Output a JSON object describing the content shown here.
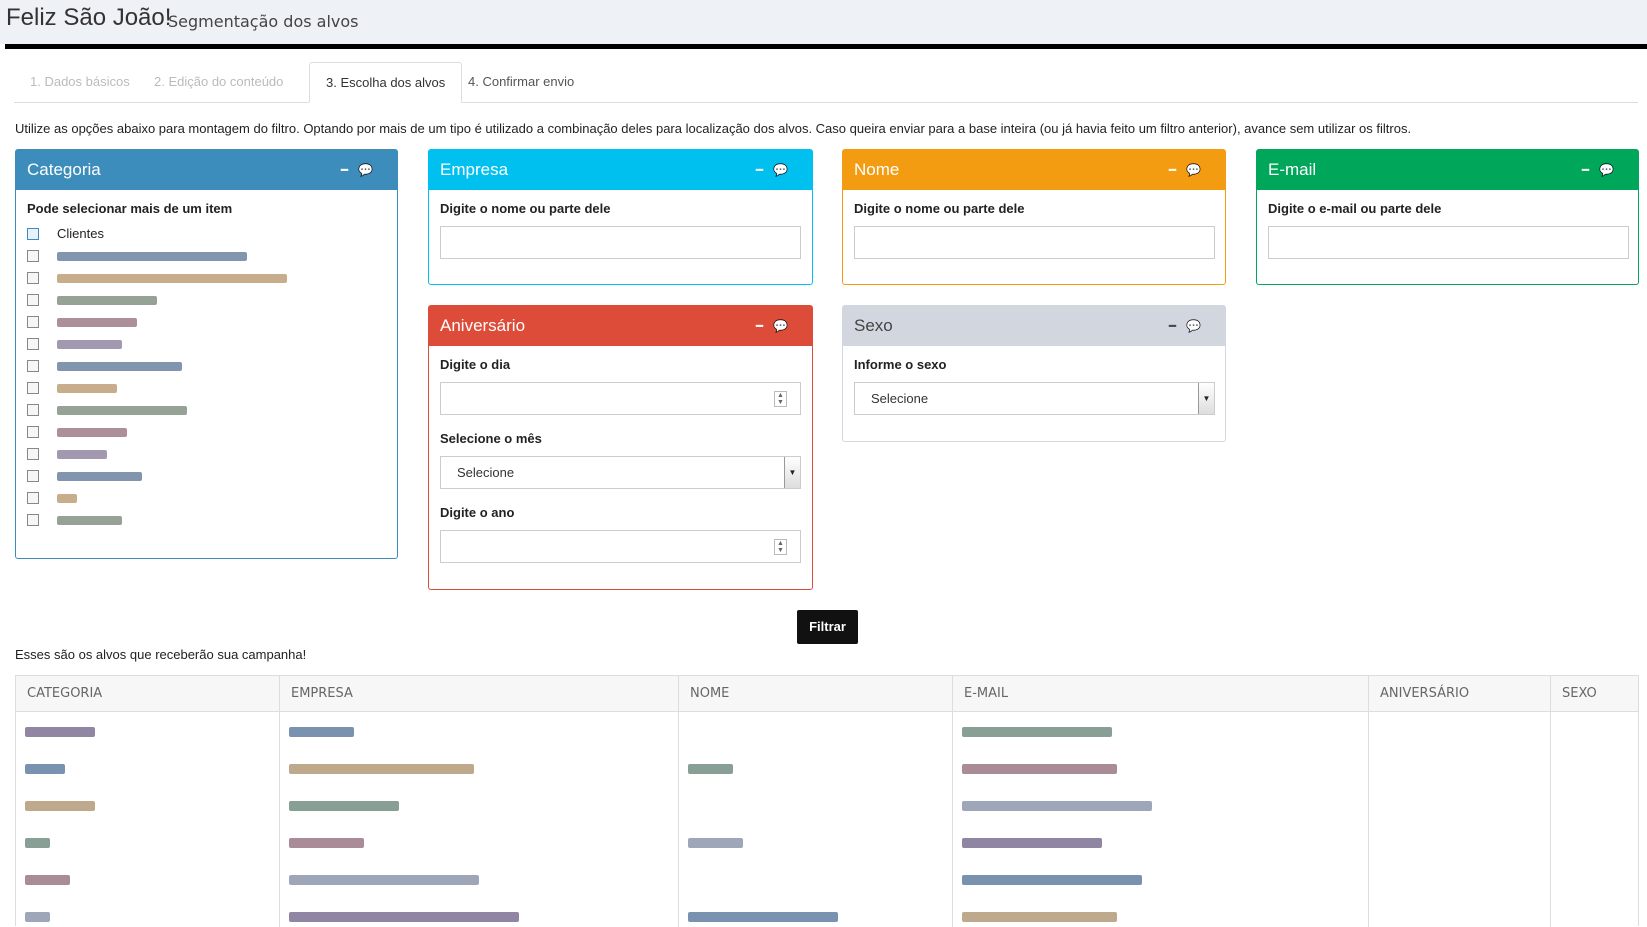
{
  "header": {
    "title": "Feliz São João!",
    "subtitle": "Segmentação dos alvos"
  },
  "tabs": [
    {
      "label": "1. Dados básicos",
      "state": "disabled"
    },
    {
      "label": "2. Edição do conteúdo",
      "state": "disabled"
    },
    {
      "label": "3. Escolha dos alvos",
      "state": "active"
    },
    {
      "label": "4. Confirmar envio",
      "state": "normal"
    }
  ],
  "intro": "Utilize as opções abaixo para montagem do filtro. Optando por mais de um tipo é utilizado a combinação deles para localização dos alvos. Caso queira enviar para a base inteira (ou já havia feito um filtro anterior), avance sem utilizar os filtros.",
  "categoria": {
    "title": "Categoria",
    "hint": "Pode selecionar mais de um item",
    "items": [
      "Clientes"
    ]
  },
  "empresa": {
    "title": "Empresa",
    "label": "Digite o nome ou parte dele",
    "value": ""
  },
  "nome": {
    "title": "Nome",
    "label": "Digite o nome ou parte dele",
    "value": ""
  },
  "email": {
    "title": "E-mail",
    "label": "Digite o e-mail ou parte dele",
    "value": ""
  },
  "aniversario": {
    "title": "Aniversário",
    "dia_label": "Digite o dia",
    "mes_label": "Selecione o mês",
    "mes_value": "Selecione",
    "ano_label": "Digite o ano"
  },
  "sexo": {
    "title": "Sexo",
    "label": "Informe o sexo",
    "value": "Selecione"
  },
  "filter_button": "Filtrar",
  "table": {
    "caption": "Esses são os alvos que receberão sua campanha!",
    "headers": [
      "CATEGORIA",
      "EMPRESA",
      "NOME",
      "E-MAIL",
      "ANIVERSÁRIO",
      "SEXO"
    ]
  },
  "colors": {
    "categoria": "#3c8dbc",
    "empresa": "#00c0ef",
    "nome": "#f39c12",
    "email": "#00a65a",
    "aniversario": "#dd4b39",
    "sexo": "#d2d6de"
  },
  "icons": {
    "collapse": "minus-icon",
    "comments": "comments-icon"
  }
}
